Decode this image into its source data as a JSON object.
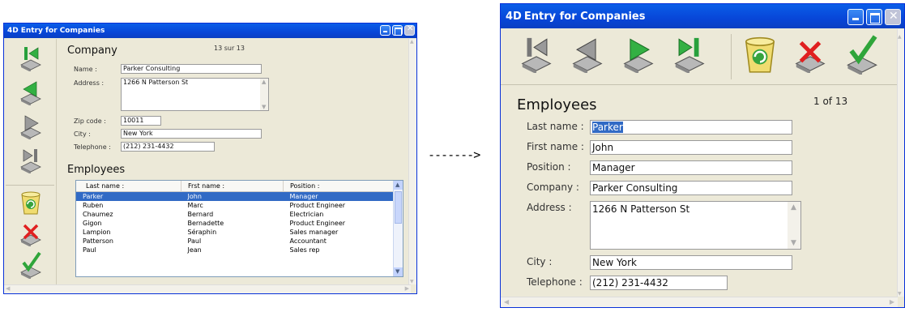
{
  "window_title": "Entry for Companies",
  "arrow": "------->",
  "left": {
    "section_company": "Company",
    "record_counter": "13 sur 13",
    "fields": [
      {
        "label": "Name :",
        "value": "Parker Consulting"
      },
      {
        "label": "Address :",
        "value": "1266 N Patterson St"
      },
      {
        "label": "Zip code :",
        "value": "10011"
      },
      {
        "label": "City :",
        "value": "New York"
      },
      {
        "label": "Telephone :",
        "value": "(212) 231-4432"
      }
    ],
    "section_employees": "Employees",
    "columns": [
      "Last name :",
      "Frst name :",
      "Position :"
    ],
    "rows": [
      {
        "last": "Parker",
        "first": "John",
        "position": "Manager"
      },
      {
        "last": "Ruben",
        "first": "Marc",
        "position": "Product Engineer"
      },
      {
        "last": "Chaumez",
        "first": "Bernard",
        "position": "Electrician"
      },
      {
        "last": "Gigon",
        "first": "Bernadette",
        "position": "Product Engineer"
      },
      {
        "last": "Lampion",
        "first": "Séraphin",
        "position": "Sales manager"
      },
      {
        "last": "Patterson",
        "first": "Paul",
        "position": "Accountant"
      },
      {
        "last": "Paul",
        "first": "Jean",
        "position": "Sales rep"
      }
    ]
  },
  "right": {
    "section_employees": "Employees",
    "record_counter": "1 of 13",
    "fields": [
      {
        "label": "Last name :",
        "value": "Parker"
      },
      {
        "label": "First name :",
        "value": "John"
      },
      {
        "label": "Position :",
        "value": "Manager"
      },
      {
        "label": "Company :",
        "value": "Parker Consulting"
      },
      {
        "label": "Address :",
        "value": "1266 N Patterson St"
      },
      {
        "label": "City :",
        "value": "New York"
      },
      {
        "label": "Telephone :",
        "value": "(212) 231-4432"
      }
    ]
  },
  "colors": {
    "title_bar": "#0a4fe0",
    "selection": "#316ac5",
    "window_bg": "#ece9d8"
  },
  "toolbar_icons": [
    "first-record-icon",
    "previous-record-icon",
    "next-record-icon",
    "last-record-icon",
    "trash-icon",
    "cancel-icon",
    "accept-icon"
  ]
}
